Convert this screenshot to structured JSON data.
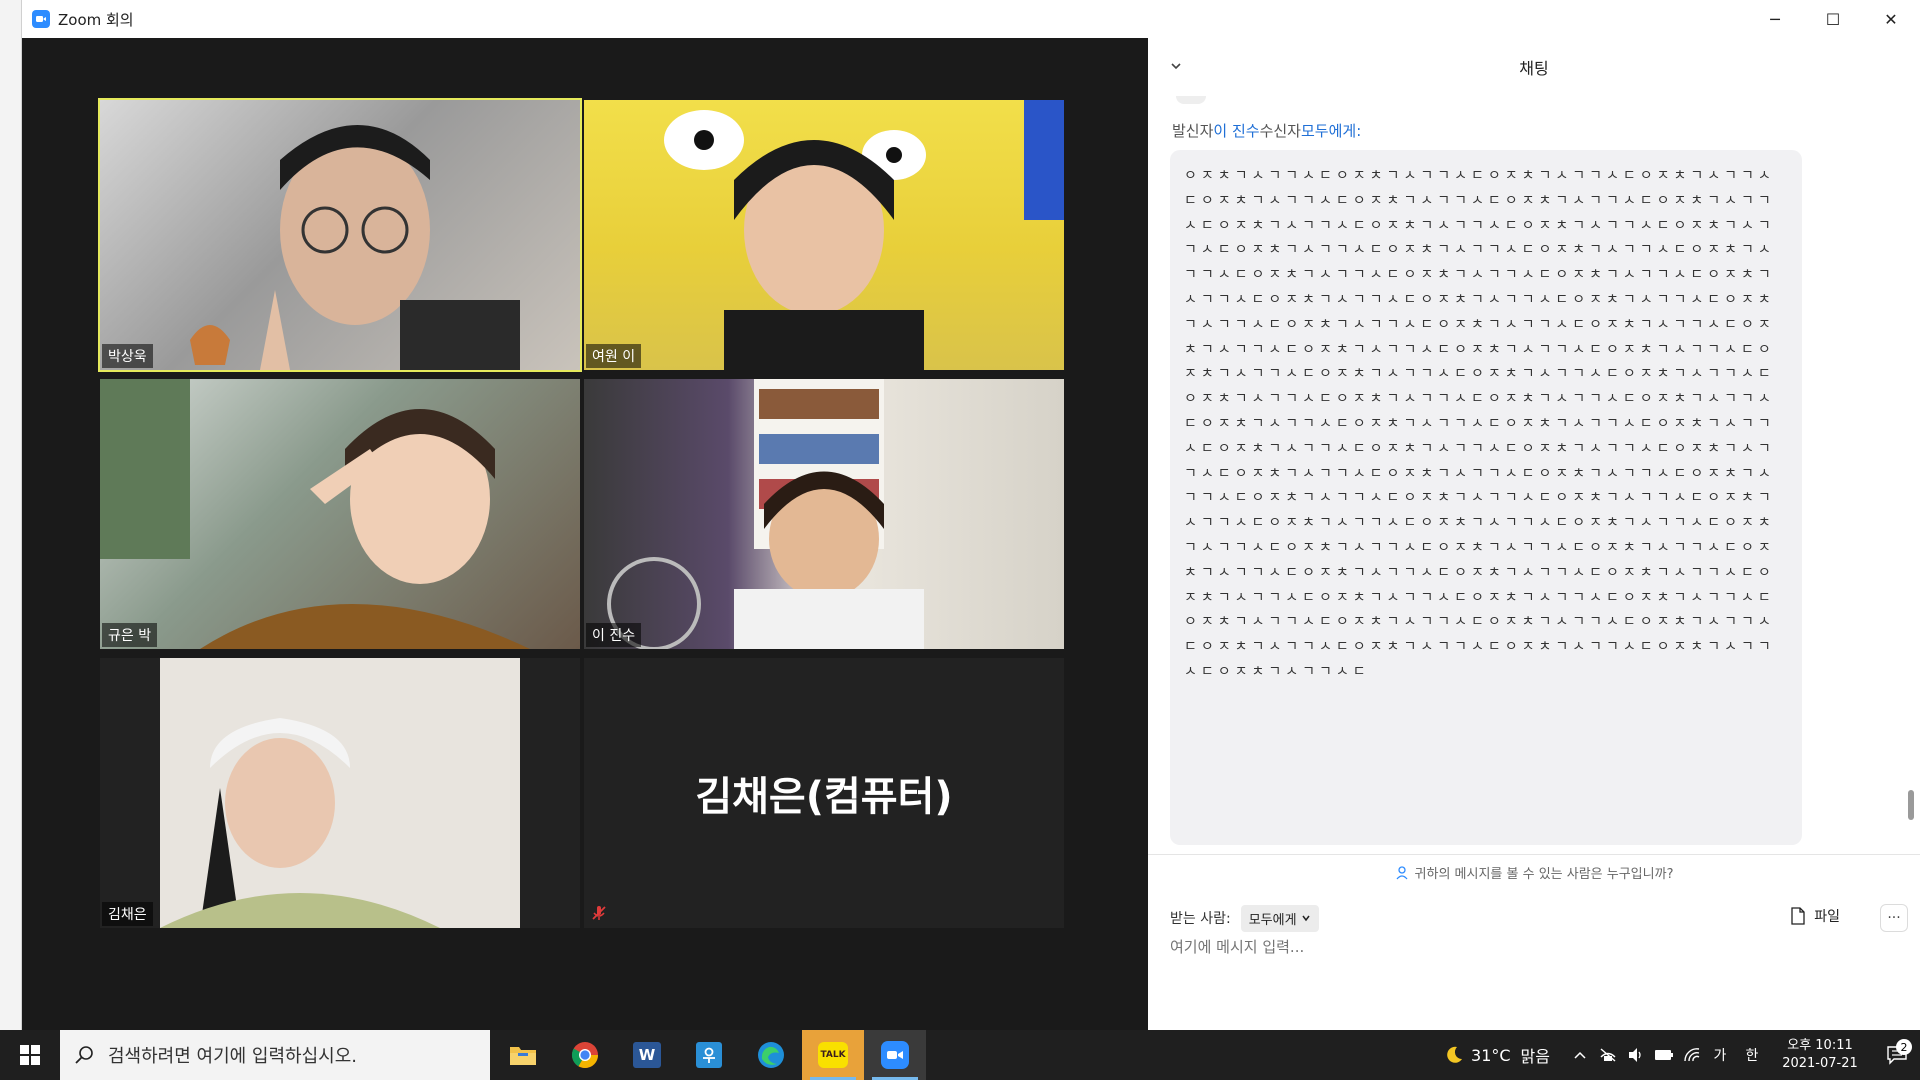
{
  "window": {
    "title": "Zoom 회의",
    "minimize": "─",
    "maximize": "☐",
    "close": "✕"
  },
  "participants": [
    {
      "name": "박상욱",
      "speaking": true,
      "video": true
    },
    {
      "name": "여원 이",
      "speaking": false,
      "video": true
    },
    {
      "name": "규은 박",
      "speaking": false,
      "video": true
    },
    {
      "name": "이 진수",
      "speaking": false,
      "video": true
    },
    {
      "name": "김채은",
      "speaking": false,
      "video": true
    },
    {
      "name": "김채은(컴퓨터)",
      "speaking": false,
      "video": false,
      "muted": true
    }
  ],
  "chat": {
    "title": "채팅",
    "sender_prefix": "발신자",
    "sender": "이 진수",
    "recipient_prefix": "수신자",
    "recipient": "모두에게",
    "colon": ":",
    "message": "ㅇㅈㅊㄱㅅㄱㄱㅅㄷㅇㅈㅊㄱㅅㄱㄱㅅㄷㅇㅈㅊㄱㅅㄱㄱㅅㄷㅇㅈㅊㄱㅅㄱㄱㅅㄷㅇㅈㅊㄱㅅㄱㄱㅅㄷㅇㅈㅊㄱㅅㄱㄱㅅㄷㅇㅈㅊㄱㅅㄱㄱㅅㄷㅇㅈㅊㄱㅅㄱㄱㅅㄷㅇㅈㅊㄱㅅㄱㄱㅅㄷㅇㅈㅊㄱㅅㄱㄱㅅㄷㅇㅈㅊㄱㅅㄱㄱㅅㄷㅇㅈㅊㄱㅅㄱㄱㅅㄷㅇㅈㅊㄱㅅㄱㄱㅅㄷㅇㅈㅊㄱㅅㄱㄱㅅㄷㅇㅈㅊㄱㅅㄱㄱㅅㄷㅇㅈㅊㄱㅅㄱㄱㅅㄷㅇㅈㅊㄱㅅㄱㄱㅅㄷㅇㅈㅊㄱㅅㄱㄱㅅㄷㅇㅈㅊㄱㅅㄱㄱㅅㄷㅇㅈㅊㄱㅅㄱㄱㅅㄷㅇㅈㅊㄱㅅㄱㄱㅅㄷㅇㅈㅊㄱㅅㄱㄱㅅㄷㅇㅈㅊㄱㅅㄱㄱㅅㄷㅇㅈㅊㄱㅅㄱㄱㅅㄷㅇㅈㅊㄱㅅㄱㄱㅅㄷㅇㅈㅊㄱㅅㄱㄱㅅㄷㅇㅈㅊㄱㅅㄱㄱㅅㄷㅇㅈㅊㄱㅅㄱㄱㅅㄷㅇㅈㅊㄱㅅㄱㄱㅅㄷㅇㅈㅊㄱㅅㄱㄱㅅㄷㅇㅈㅊㄱㅅㄱㄱㅅㄷㅇㅈㅊㄱㅅㄱㄱㅅㄷㅇㅈㅊㄱㅅㄱㄱㅅㄷㅇㅈㅊㄱㅅㄱㄱㅅㄷㅇㅈㅊㄱㅅㄱㄱㅅㄷㅇㅈㅊㄱㅅㄱㄱㅅㄷㅇㅈㅊㄱㅅㄱㄱㅅㄷㅇㅈㅊㄱㅅㄱㄱㅅㄷㅇㅈㅊㄱㅅㄱㄱㅅㄷㅇㅈㅊㄱㅅㄱㄱㅅㄷㅇㅈㅊㄱㅅㄱㄱㅅㄷㅇㅈㅊㄱㅅㄱㄱㅅㄷㅇㅈㅊㄱㅅㄱㄱㅅㄷㅇㅈㅊㄱㅅㄱㄱㅅㄷㅇㅈㅊㄱㅅㄱㄱㅅㄷㅇㅈㅊㄱㅅㄱㄱㅅㄷㅇㅈㅊㄱㅅㄱㄱㅅㄷㅇㅈㅊㄱㅅㄱㄱㅅㄷㅇㅈㅊㄱㅅㄱㄱㅅㄷㅇㅈㅊㄱㅅㄱㄱㅅㄷㅇㅈㅊㄱㅅㄱㄱㅅㄷㅇㅈㅊㄱㅅㄱㄱㅅㄷㅇㅈㅊㄱㅅㄱㄱㅅㄷㅇㅈㅊㄱㅅㄱㄱㅅㄷㅇㅈㅊㄱㅅㄱㄱㅅㄷㅇㅈㅊㄱㅅㄱㄱㅅㄷㅇㅈㅊㄱㅅㄱㄱㅅㄷㅇㅈㅊㄱㅅㄱㄱㅅㄷㅇㅈㅊㄱㅅㄱㄱㅅㄷㅇㅈㅊㄱㅅㄱㄱㅅㄷㅇㅈㅊㄱㅅㄱㄱㅅㄷㅇㅈㅊㄱㅅㄱㄱㅅㄷㅇㅈㅊㄱㅅㄱㄱㅅㄷㅇㅈㅊㄱㅅㄱㄱㅅㄷㅇㅈㅊㄱㅅㄱㄱㅅㄷㅇㅈㅊㄱㅅㄱㄱㅅㄷㅇㅈㅊㄱㅅㄱㄱㅅㄷㅇㅈㅊㄱㅅㄱㄱㅅㄷㅇㅈㅊㄱㅅㄱㄱㅅㄷㅇㅈㅊㄱㅅㄱㄱㅅㄷㅇㅈㅊㄱㅅㄱㄱㅅㄷㅇㅈㅊㄱㅅㄱㄱㅅㄷㅇㅈㅊㄱㅅㄱㄱㅅㄷㅇㅈㅊㄱㅅㄱㄱㅅㄷㅇㅈㅊㄱㅅㄱㄱㅅㄷㅇㅈㅊㄱㅅㄱㄱㅅㄷㅇㅈㅊㄱㅅㄱㄱㅅㄷㅇㅈㅊㄱㅅㄱㄱㅅㄷㅇㅈㅊㄱㅅㄱㄱㅅㄷ",
    "visibility_notice": "귀하의 메시지를 볼 수 있는 사람은 누구입니까?",
    "to_label": "받는 사람:",
    "to_value": "모두에게",
    "file_label": "파일",
    "more_label": "···",
    "input_placeholder": "여기에 메시지 입력..."
  },
  "taskbar": {
    "search_placeholder": "검색하려면 여기에 입력하십시오.",
    "apps": [
      "file-explorer",
      "chrome",
      "word",
      "hangul",
      "edge",
      "kakaotalk",
      "zoom"
    ],
    "kakao_label": "TALK",
    "word_label": "W",
    "weather_temp": "31°C",
    "weather_desc": "맑음",
    "ime_label": "가",
    "lang_label": "한",
    "clock_time": "오후 10:11",
    "clock_date": "2021-07-21",
    "notification_count": "2"
  },
  "colors": {
    "zoom_blue": "#2d8cff",
    "speaker_outline": "#e6ea5c",
    "link_blue": "#1f6fd6",
    "kakao_yellow": "#f9e000"
  }
}
